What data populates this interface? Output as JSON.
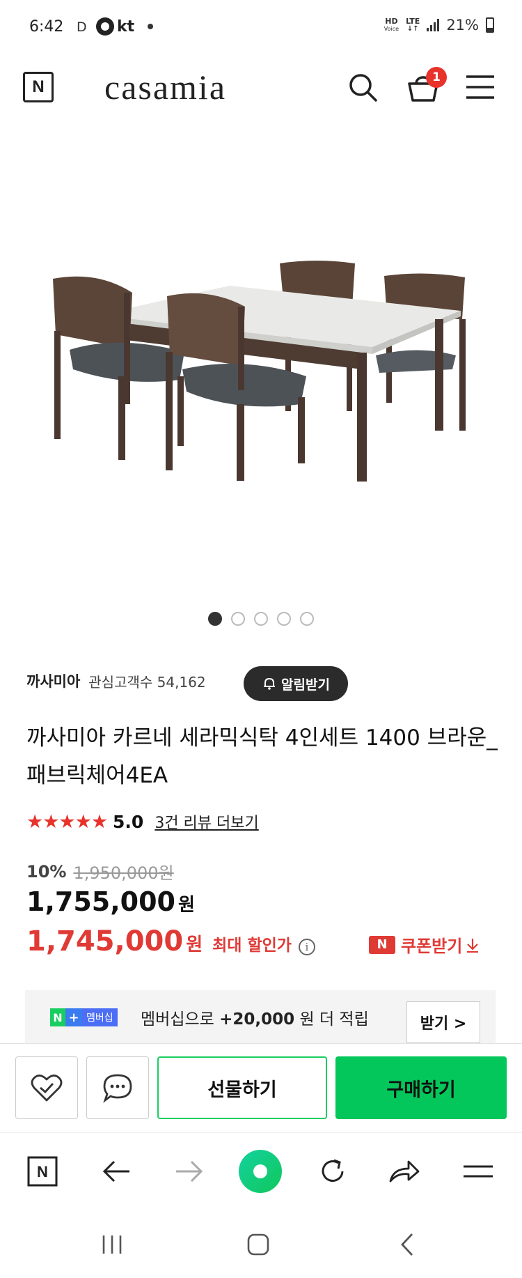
{
  "status_bar": {
    "time": "6:42",
    "indicator": "D",
    "carrier": "kt",
    "hd_top": "HD",
    "hd_bottom": "Voice",
    "lte": "LTE",
    "battery": "21%"
  },
  "header": {
    "brand": "casamia",
    "cart_count": "1",
    "logo_letter": "N"
  },
  "gallery": {
    "total_slides": 5,
    "active_index": 0
  },
  "store": {
    "name": "까사미아",
    "watch_label": "관심고객수 54,162",
    "alarm_label": "알림받기"
  },
  "product": {
    "title": "까사미아 카르네 세라믹식탁 4인세트 1400 브라운_패브릭체어4EA",
    "stars": "★★★★★",
    "rating": "5.0",
    "review_link": "3건 리뷰 더보기",
    "discount_rate": "10%",
    "original_price": "1,950,000원",
    "price": "1,755,000",
    "price_unit": "원",
    "max_discount_price": "1,745,000",
    "max_discount_unit": "원",
    "max_discount_label": "최대 할인가",
    "coupon_label": "쿠폰받기",
    "coupon_badge": "N"
  },
  "membership": {
    "badge_n": "N",
    "badge_plus": "+",
    "badge_text": "멤버십",
    "text_prefix": "멤버십으로 ",
    "points": "+20,000",
    "text_suffix": " 원 더 적립",
    "button": "받기 >"
  },
  "buy_bar": {
    "gift_label": "선물하기",
    "buy_label": "구매하기"
  },
  "colors": {
    "accent_red": "#e03a35",
    "naver_green": "#03c75a",
    "badge_red": "#e8322c"
  }
}
